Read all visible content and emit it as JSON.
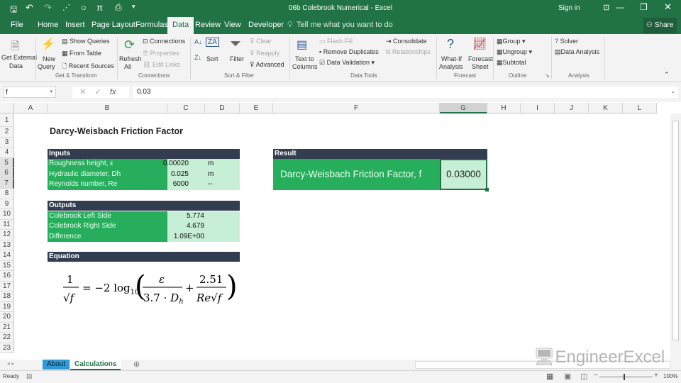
{
  "title": "06b Colebrook Numerical - Excel",
  "sign_in": "Sign in",
  "share": "Share",
  "tabs": [
    "File",
    "Home",
    "Insert",
    "Page Layout",
    "Formulas",
    "Data",
    "Review",
    "View",
    "Developer"
  ],
  "tell_me": "Tell me what you want to do",
  "ribbon": {
    "get_external": "Get External",
    "get_external2": "Data",
    "new_query": "New",
    "new_query2": "Query",
    "show_queries": "Show Queries",
    "from_table": "From Table",
    "recent_sources": "Recent Sources",
    "refresh": "Refresh",
    "refresh2": "All",
    "connections": "Connections",
    "properties": "Properties",
    "edit_links": "Edit Links",
    "sort": "Sort",
    "filter": "Filter",
    "clear": "Clear",
    "reapply": "Reapply",
    "advanced": "Advanced",
    "text_to": "Text to",
    "columns": "Columns",
    "flash_fill": "Flash Fill",
    "remove_dup": "Remove Duplicates",
    "data_validation": "Data Validation",
    "consolidate": "Consolidate",
    "relationships": "Relationships",
    "whatif": "What-If",
    "analysis": "Analysis",
    "forecast": "Forecast",
    "sheet": "Sheet",
    "group": "Group",
    "ungroup": "Ungroup",
    "subtotal": "Subtotal",
    "solver": "Solver",
    "data_analysis": "Data Analysis",
    "groups": [
      "Get & Transform",
      "Connections",
      "Sort & Filter",
      "Data Tools",
      "Forecast",
      "Outline",
      "Analysis"
    ]
  },
  "name_box": "f",
  "formula": "0.03",
  "columns": [
    "A",
    "B",
    "C",
    "D",
    "E",
    "F",
    "G",
    "H",
    "I",
    "J",
    "K",
    "L"
  ],
  "rows": [
    "1",
    "2",
    "3",
    "4",
    "5",
    "6",
    "7",
    "8",
    "9",
    "10",
    "11",
    "12",
    "13",
    "14",
    "15",
    "16",
    "17",
    "18",
    "19",
    "20",
    "21",
    "22",
    "23"
  ],
  "sheet": {
    "heading": "Darcy-Weisbach Friction Factor",
    "inputs_header": "Inputs",
    "inputs": [
      {
        "label": "Roughness height, ε",
        "value": "0.00020",
        "unit": "m"
      },
      {
        "label": "Hydraulic diameter, Dh",
        "value": "0.025",
        "unit": "m"
      },
      {
        "label": "Reynolds number, Re",
        "value": "6000",
        "unit": "--"
      }
    ],
    "outputs_header": "Outputs",
    "outputs": [
      {
        "label": "Colebrook Left Side",
        "value": "5.774"
      },
      {
        "label": "Colebrook Right Side",
        "value": "4.679"
      },
      {
        "label": "Difference",
        "value": "1.09E+00"
      }
    ],
    "equation_header": "Equation",
    "result_header": "Result",
    "result_label": "Darcy-Weisbach Friction Factor, f",
    "result_value": "0.03000"
  },
  "sheet_tabs": [
    "About",
    "Calculations"
  ],
  "watermark": "EngineerExcel",
  "status": "Ready",
  "zoom": "100%"
}
